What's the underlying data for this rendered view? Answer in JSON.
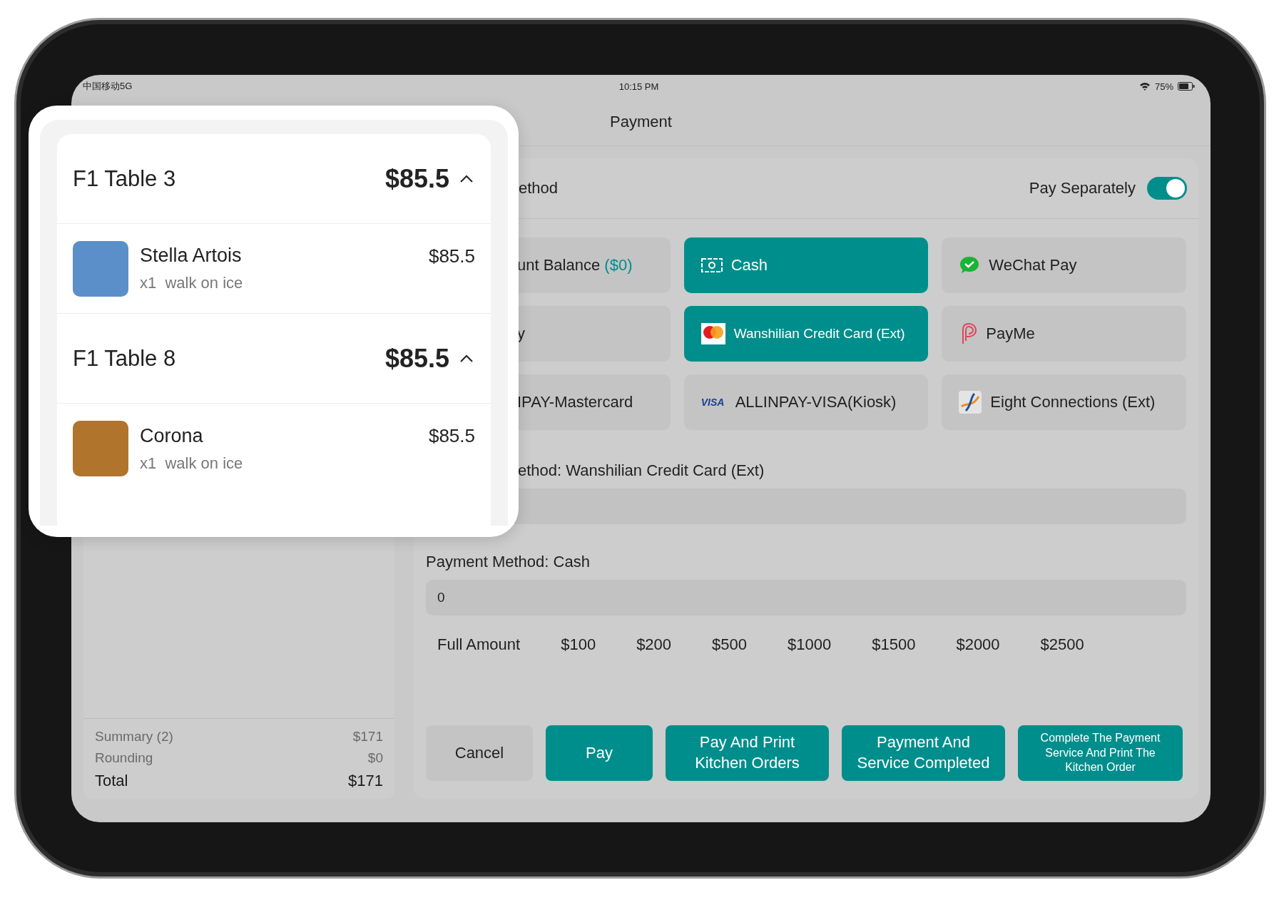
{
  "status_bar": {
    "carrier": "中国移动5G",
    "time": "10:15 PM",
    "battery": "75%"
  },
  "header": {
    "title": "Payment"
  },
  "order_popup": {
    "groups": [
      {
        "table": "F1 Table 3",
        "total": "$85.5",
        "expanded": true,
        "items": [
          {
            "name": "Stella Artois",
            "price": "$85.5",
            "quantity": "x1",
            "note": "walk on ice"
          }
        ]
      },
      {
        "table": "F1 Table 8",
        "total": "$85.5",
        "expanded": true,
        "items": [
          {
            "name": "Corona",
            "price": "$85.5",
            "quantity": "x1",
            "note": "walk on ice"
          }
        ]
      }
    ]
  },
  "summary": [
    {
      "kind": "normal",
      "label": "Summary (2)",
      "value": "$171"
    },
    {
      "kind": "normal",
      "label": "Rounding",
      "value": "$0"
    },
    {
      "kind": "total",
      "label": "Total",
      "value": "$171"
    }
  ],
  "payment": {
    "section_title": "ethod",
    "pay_separately": {
      "label": "Pay Separately",
      "on": true
    },
    "methods": [
      {
        "label": "unt Balance",
        "balance": "($0)",
        "kind": "plain",
        "selected": false
      },
      {
        "label": "Cash",
        "kind": "cash",
        "selected": true
      },
      {
        "label": "WeChat Pay",
        "kind": "wechat",
        "selected": false
      },
      {
        "label": "y",
        "kind": "plain",
        "selected": false
      },
      {
        "label": "Wanshilian Credit Card (Ext)",
        "kind": "mastercard",
        "selected": true
      },
      {
        "label": "PayMe",
        "kind": "payme",
        "selected": false
      },
      {
        "label": "IPAY-Mastercard",
        "kind": "plain",
        "selected": false
      },
      {
        "label": "ALLINPAY-VISA(Kiosk)",
        "kind": "visa",
        "logo_text": "VISA",
        "selected": false
      },
      {
        "label": "Eight Connections (Ext)",
        "kind": "swirl",
        "selected": false
      }
    ],
    "entries": [
      {
        "label": "ethod: Wanshilian Credit Card (Ext)"
      },
      {
        "label": "Payment Method: Cash",
        "value": "0"
      }
    ],
    "quick_amounts": [
      "Full Amount",
      "$100",
      "$200",
      "$500",
      "$1000",
      "$1500",
      "$2000",
      "$2500"
    ],
    "buttons": [
      {
        "label": "Cancel",
        "kind": "secondary"
      },
      {
        "label": "Pay",
        "kind": "primary"
      },
      {
        "label": "Pay And Print Kitchen Orders",
        "kind": "primary"
      },
      {
        "label": "Payment And Service Completed",
        "kind": "primary"
      },
      {
        "label": "Complete The Payment Service And Print The Kitchen Order",
        "kind": "compact"
      }
    ]
  }
}
